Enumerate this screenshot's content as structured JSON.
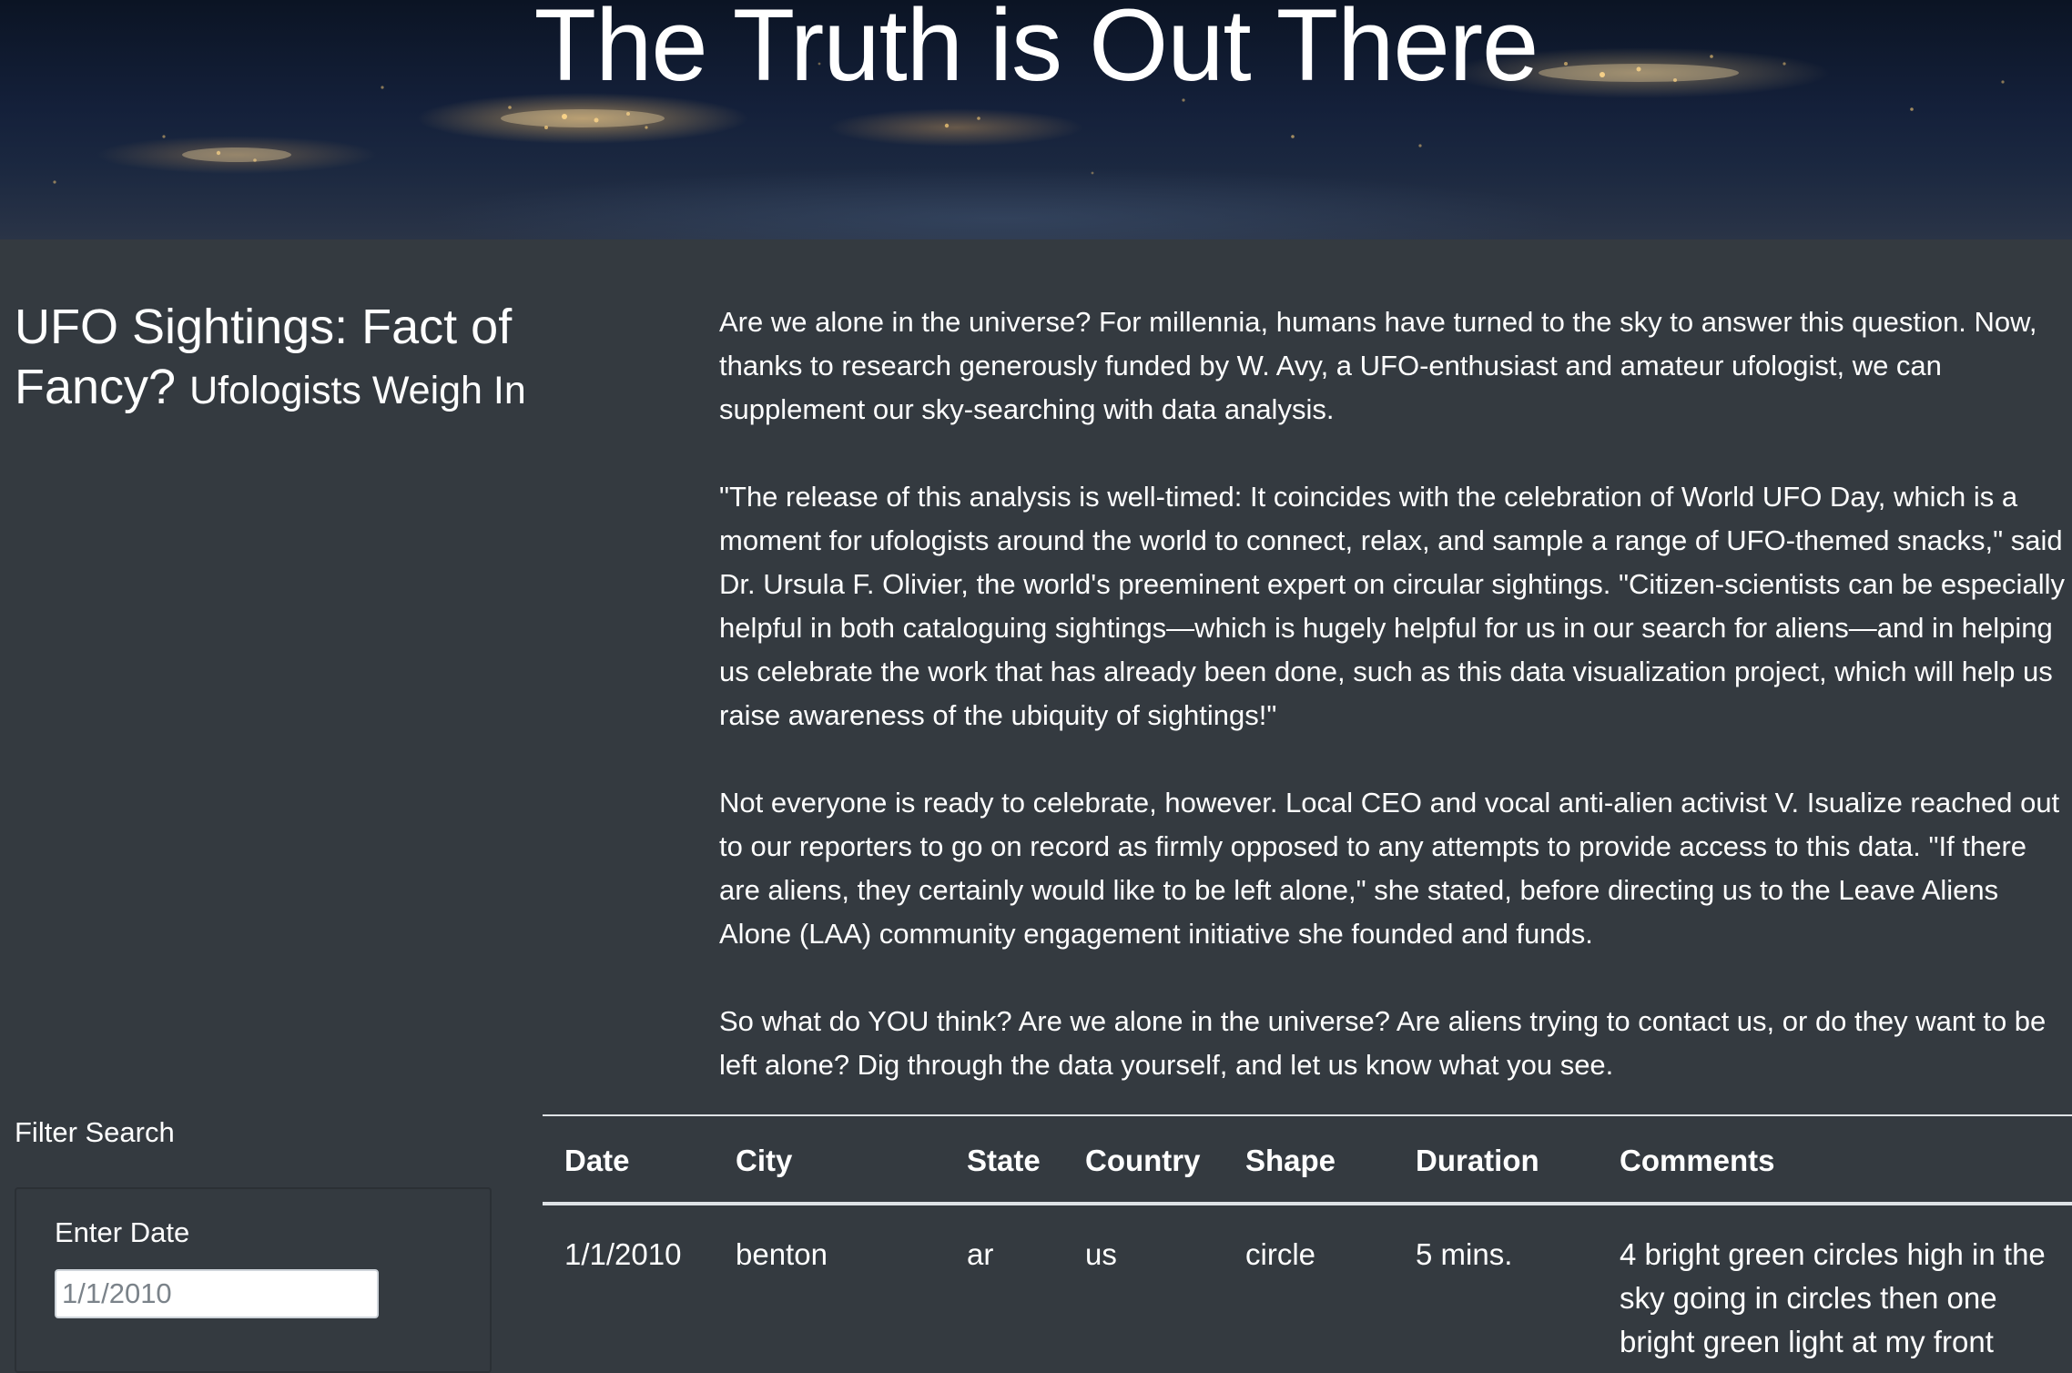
{
  "hero": {
    "title": "The Truth is Out There"
  },
  "headline": {
    "title": "UFO Sightings: Fact of Fancy?",
    "subtitle": "Ufologists Weigh In"
  },
  "article": {
    "paragraphs": [
      "Are we alone in the universe? For millennia, humans have turned to the sky to answer this question. Now, thanks to research generously funded by W. Avy, a UFO-enthusiast and amateur ufologist, we can supplement our sky-searching with data analysis.",
      "\"The release of this analysis is well-timed: It coincides with the celebration of World UFO Day, which is a moment for ufologists around the world to connect, relax, and sample a range of UFO-themed snacks,\" said Dr. Ursula F. Olivier, the world's preeminent expert on circular sightings. \"Citizen-scientists can be especially helpful in both cataloguing sightings—which is hugely helpful for us in our search for aliens—and in helping us celebrate the work that has already been done, such as this data visualization project, which will help us raise awareness of the ubiquity of sightings!\"",
      "Not everyone is ready to celebrate, however. Local CEO and vocal anti-alien activist V. Isualize reached out to our reporters to go on record as firmly opposed to any attempts to provide access to this data. \"If there are aliens, they certainly would like to be left alone,\" she stated, before directing us to the Leave Aliens Alone (LAA) community engagement initiative she founded and funds.",
      "So what do YOU think? Are we alone in the universe? Are aliens trying to contact us, or do they want to be left alone? Dig through the data yourself, and let us know what you see."
    ]
  },
  "filter": {
    "title": "Filter Search",
    "date_label": "Enter Date",
    "date_placeholder": "1/1/2010"
  },
  "table": {
    "headers": [
      "Date",
      "City",
      "State",
      "Country",
      "Shape",
      "Duration",
      "Comments"
    ],
    "rows": [
      {
        "date": "1/1/2010",
        "city": "benton",
        "state": "ar",
        "country": "us",
        "shape": "circle",
        "duration": "5 mins.",
        "comments": "4 bright green circles high in the sky going in circles then one bright green light at my front"
      }
    ]
  }
}
